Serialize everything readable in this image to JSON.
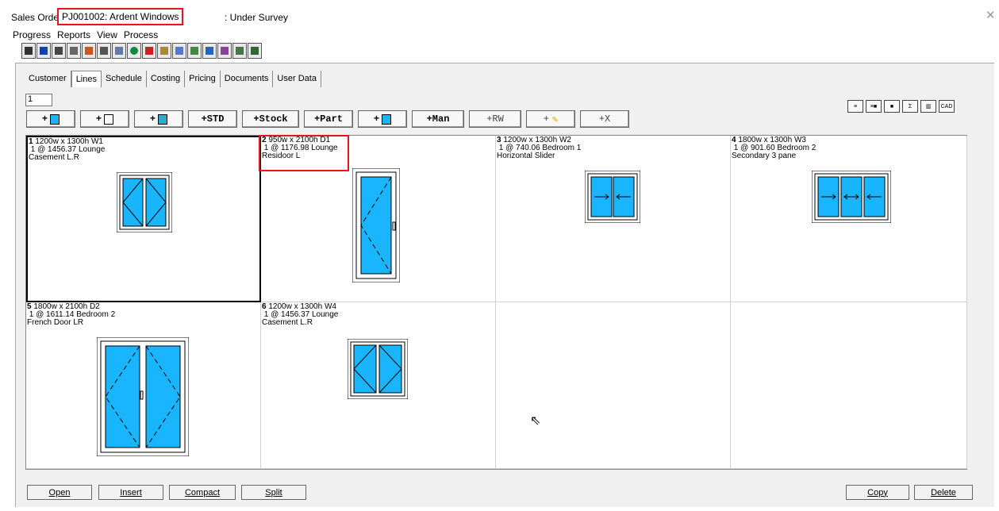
{
  "titlebar": {
    "prefix": "Sales Order",
    "order_code": "PJ001002: Ardent Windows",
    "status": ": Under Survey",
    "close_glyph": "✕"
  },
  "menu": [
    "Progress",
    "Reports",
    "View",
    "Process"
  ],
  "toolbar_icons": [
    "save-icon",
    "report-icon",
    "home-icon",
    "pack-icon",
    "chart-icon",
    "grid-icon",
    "calc-icon",
    "globe-icon",
    "house-icon",
    "copy-icon",
    "edit-icon",
    "print-icon",
    "image-icon",
    "list-icon",
    "paste-icon",
    "map-icon"
  ],
  "tabs": [
    "Customer",
    "Lines",
    "Schedule",
    "Costing",
    "Pricing",
    "Documents",
    "User Data"
  ],
  "active_tab": "Lines",
  "line_number": "1",
  "add_buttons": [
    {
      "label": "+",
      "icon": "window-icon"
    },
    {
      "label": "+",
      "icon": "door-icon"
    },
    {
      "label": "+",
      "icon": "grid-icon"
    },
    {
      "label": "+STD"
    },
    {
      "label": "+Stock"
    },
    {
      "label": "+Part"
    },
    {
      "label": "+",
      "icon": "glass-icon"
    },
    {
      "label": "+Man"
    },
    {
      "label": "+RW"
    },
    {
      "label": "+",
      "icon": "flag-icon"
    },
    {
      "label": "+X"
    }
  ],
  "right_tools": [
    "≡",
    "≡■",
    "■",
    "Σ",
    "▥",
    "CAD"
  ],
  "lines": [
    {
      "num": "1",
      "size": "1200w x 1300h  W1",
      "price": "1 @ 1456.37  Lounge",
      "type": "Casement L.R"
    },
    {
      "num": "2",
      "size": "950w x 2100h  D1",
      "price": "1 @ 1176.98  Lounge",
      "type": "Residoor L"
    },
    {
      "num": "3",
      "size": "1200w x 1300h  W2",
      "price": "1 @ 740.06  Bedroom 1",
      "type": "Horizontal Slider"
    },
    {
      "num": "4",
      "size": "1800w x 1300h  W3",
      "price": "1 @ 901.60  Bedroom 2",
      "type": "Secondary  3 pane"
    },
    {
      "num": "5",
      "size": "1800w x 2100h  D2",
      "price": "1 @ 1611.14  Bedroom 2",
      "type": "French Door LR"
    },
    {
      "num": "6",
      "size": "1200w x 1300h  W4",
      "price": "1 @ 1456.37  Lounge",
      "type": "Casement L.R"
    }
  ],
  "bottom_buttons": {
    "open": "Open",
    "insert": "Insert",
    "compact": "Compact",
    "split": "Split",
    "copy": "Copy",
    "delete": "Delete"
  },
  "colors": {
    "highlight": "#e8141c",
    "glass": "#19b5ff",
    "frame": "#ffffff"
  }
}
